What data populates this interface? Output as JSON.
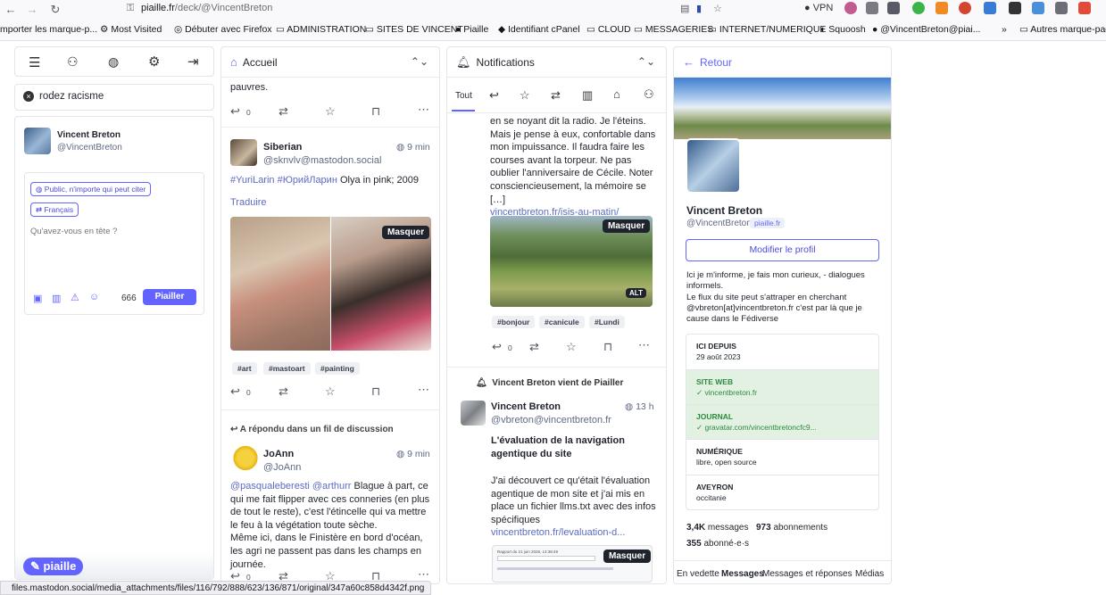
{
  "browser": {
    "url_host": "piaille.fr",
    "url_path": "/deck/@VincentBreton",
    "vpn_label": "VPN",
    "bookmarks": [
      "mporter les marque-p...",
      "Most Visited",
      "Débuter avec Firefox",
      "ADMINISTRATION",
      "SITES DE VINCENT",
      "Piaille",
      "Identifiant cPanel",
      "CLOUD",
      "MESSAGERIES",
      "INTERNET/NUMERIQUE",
      "Squoosh",
      "@VincentBreton@piai...",
      "Autres marque-pag"
    ],
    "status_url": "files.mastodon.social/media_attachments/files/116/792/888/623/136/871/original/347a60c858d4342f.png"
  },
  "compose": {
    "search_value": "rodez racisme",
    "user_name": "Vincent Breton",
    "user_handle": "@VincentBreton",
    "visibility": "Public, n'importe qui peut citer",
    "language": "Français",
    "placeholder": "Qu'avez-vous en tête ?",
    "char_count": "666",
    "publish": "Piailler",
    "logo": "piaille"
  },
  "home": {
    "title": "Accueil",
    "post0": {
      "text": "pauvres.",
      "reply_count": "0"
    },
    "post1": {
      "name": "Siberian",
      "handle": "@sknvlv@mastodon.social",
      "time": "9 min",
      "tags_text": "#YuriLarin #ЮрийЛарин",
      "text": " Olya in pink; 2009",
      "translate": "Traduire",
      "hide": "Masquer",
      "tags": [
        "#art",
        "#mastoart",
        "#painting"
      ],
      "reply_count": "0"
    },
    "post2": {
      "context": "A répondu dans un fil de discussion",
      "name": "JoAnn",
      "handle": "@JoAnn",
      "time": "9 min",
      "mentions": "@pasqualeberesti @arthurr",
      "text": " Blague à part, ce qui me fait flipper avec ces conneries (en plus de tout le reste), c'est l'étincelle qui va mettre le feu à la végétation toute sèche.",
      "text2": "Même ici, dans le Finistère en bord d'océan, les agri ne passent pas dans les champs en journée.",
      "reply_count": "0"
    }
  },
  "notif": {
    "title": "Notifications",
    "tab_all": "Tout",
    "post0": {
      "text": "en se noyant dit la radio. Je l'éteins. Mais je pense à eux, confortable dans mon impuissance. Il faudra faire les courses avant la torpeur. Ne pas oublier l'anniversaire de Cécile. Noter consciencieusement, la mémoire se […]",
      "link": "vincentbreton.fr/isis-au-matin/",
      "hide": "Masquer",
      "alt": "ALT",
      "tags": [
        "#bonjour",
        "#canicule",
        "#Lundi"
      ],
      "reply_count": "0"
    },
    "post1": {
      "context": "Vincent Breton vient de Piailler",
      "name": "Vincent Breton",
      "handle": "@vbreton@vincentbreton.fr",
      "time": "13 h",
      "title": "L'évaluation de la navigation agentique du site",
      "text": "J'ai découvert ce qu'était l'évaluation agentique de mon site et j'ai mis en place un fichier llms.txt avec des infos spécifiques",
      "link": "vincentbreton.fr/levaluation-d...",
      "preview": "Rapport du 21 juin 2026, 14:38:49",
      "hide": "Masquer"
    }
  },
  "profile": {
    "back": "Retour",
    "name": "Vincent Breton",
    "handle": "@VincentBreton",
    "domain": "piaille.fr",
    "edit": "Modifier le profil",
    "bio1": "Ici je m'informe, je fais mon curieux, - dialogues informels.",
    "bio2": "Le flux du site peut s'attraper en cherchant @vbreton[at]vincentbreton.fr c'est par là que je cause dans le Fédiverse",
    "fields": [
      {
        "label": "ICI DEPUIS",
        "value": "29 août 2023"
      },
      {
        "label": "SITE WEB",
        "value": "vincentbreton.fr"
      },
      {
        "label": "JOURNAL",
        "value": "gravatar.com/vincentbretoncfc9..."
      },
      {
        "label": "NUMÉRIQUE",
        "value": "libre, open source"
      },
      {
        "label": "AVEYRON",
        "value": "occitanie"
      }
    ],
    "stats": {
      "messages_n": "3,4K",
      "messages_l": "messages",
      "followers_n": "973",
      "followers_l": "abonnements",
      "following_n": "355",
      "following_l": "abonné·e·s"
    },
    "tabs": [
      "En vedette",
      "Messages",
      "Messages et réponses",
      "Médias"
    ]
  },
  "colors": {
    "accent": "#6364ff",
    "verified": "#2b8a3e"
  }
}
